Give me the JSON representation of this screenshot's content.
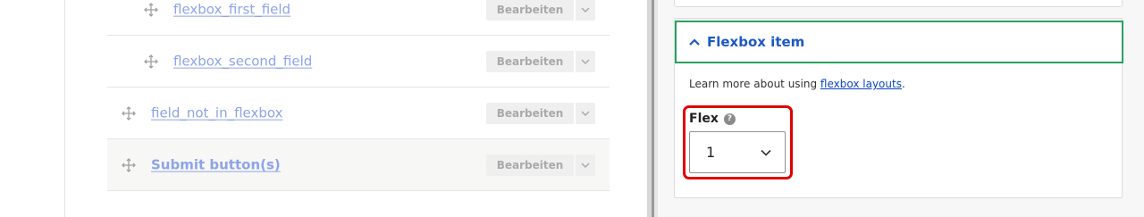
{
  "layout_rows": [
    {
      "field": "flexbox_first_field",
      "edit_label": "Bearbeiten",
      "bold": false
    },
    {
      "field": "flexbox_second_field",
      "edit_label": "Bearbeiten",
      "bold": false
    },
    {
      "field": "field_not_in_flexbox",
      "edit_label": "Bearbeiten",
      "bold": false
    },
    {
      "field": "Submit button(s)",
      "edit_label": "Bearbeiten",
      "bold": true
    }
  ],
  "sidebar": {
    "section_title": "Flexbox item",
    "help_text_prefix": "Learn more about using ",
    "help_link_text": "flexbox layouts",
    "help_text_suffix": ".",
    "flex_label": "Flex",
    "help_icon_glyph": "?",
    "flex_selected": "1"
  },
  "colors": {
    "link": "#8ea4e8",
    "section_title": "#1d58c4",
    "focus_border": "#29a15f",
    "highlight": "#e10000"
  },
  "icons": {
    "drag": "drag-handle-icon",
    "toggle": "chevron-down-icon",
    "section": "chevron-up-icon",
    "help": "help-icon"
  }
}
